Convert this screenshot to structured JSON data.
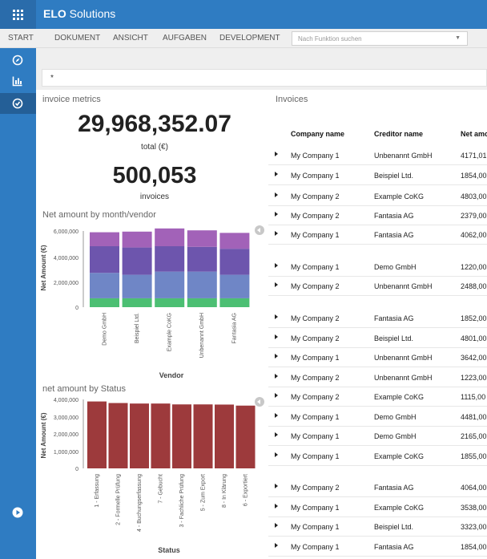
{
  "app": {
    "brand": "ELO",
    "name": "Solutions"
  },
  "menu": [
    "START",
    "DOKUMENT",
    "ANSICHT",
    "AUFGABEN",
    "DEVELOPMENT"
  ],
  "function_search": {
    "placeholder": "Nach Funktion suchen"
  },
  "sidebar": {
    "icons": [
      "compass-icon",
      "bar-chart-icon",
      "dashboard-icon"
    ],
    "bottom_icon": "play-circle-icon"
  },
  "search": {
    "value": "*"
  },
  "metrics": {
    "title": "invoice metrics",
    "total": "29,968,352.07",
    "total_label": "total (€)",
    "count": "500,053",
    "count_label": "invoices"
  },
  "charts": {
    "vendor": {
      "title": "Net amount by month/vendor",
      "ticks": [
        "6,000,000",
        "4,000,000",
        "2,000,000",
        "0"
      ],
      "ylabel": "Net Amount (€)",
      "xlabel": "Vendor"
    },
    "status": {
      "title": "net amount by Status",
      "ticks": [
        "4,000,000",
        "3,000,000",
        "2,000,000",
        "1,000,000",
        "0"
      ],
      "ylabel": "Net Amount (€)",
      "xlabel": "Status"
    }
  },
  "chart_data": [
    {
      "type": "bar",
      "title": "Net amount by month/vendor",
      "xlabel": "Vendor",
      "ylabel": "Net Amount (€)",
      "ylim": [
        0,
        6500000
      ],
      "categories": [
        "Demo GmbH",
        "Beispiel Ltd.",
        "Example CoKG",
        "Unbenannt GmbH",
        "Fantasia AG"
      ],
      "stacked": true,
      "series": [
        {
          "values": [
            700000,
            700000,
            700000,
            700000,
            700000
          ],
          "color": "#4cbf73"
        },
        {
          "values": [
            2000000,
            1850000,
            2100000,
            2100000,
            1850000
          ],
          "color": "#6f86c6"
        },
        {
          "values": [
            2100000,
            2150000,
            2000000,
            1950000,
            2050000
          ],
          "color": "#6d55ad"
        },
        {
          "values": [
            1100000,
            1250000,
            1400000,
            1300000,
            1250000
          ],
          "color": "#a262b8"
        }
      ]
    },
    {
      "type": "bar",
      "title": "net amount by Status",
      "xlabel": "Status",
      "ylabel": "Net Amount (€)",
      "ylim": [
        0,
        4000000
      ],
      "categories": [
        "1 - Erfassung",
        "2 - Formelle Prüfung",
        "4 - Buchungserfassung",
        "7 - Gebucht",
        "3 - Fachliche Prüfung",
        "5 - Zum Export",
        "8 - In Klärung",
        "6 - Exportiert"
      ],
      "series": [
        {
          "values": [
            3880000,
            3790000,
            3760000,
            3760000,
            3710000,
            3710000,
            3700000,
            3640000
          ],
          "color": "#9d3a3c"
        }
      ]
    }
  ],
  "invoices": {
    "title": "Invoices",
    "columns": [
      "Company name",
      "Creditor name",
      "Net amo"
    ],
    "rows": [
      {
        "company": "My Company 1",
        "creditor": "Unbenannt GmbH",
        "net": "4171,01"
      },
      {
        "company": "My Company 1",
        "creditor": "Beispiel Ltd.",
        "net": "1854,00"
      },
      {
        "company": "My Company 2",
        "creditor": "Example CoKG",
        "net": "4803,00"
      },
      {
        "company": "My Company 2",
        "creditor": "Fantasia AG",
        "net": "2379,00"
      },
      {
        "company": "My Company 1",
        "creditor": "Fantasia AG",
        "net": "4062,00"
      },
      {
        "company": "My Company 1",
        "creditor": "Demo GmbH",
        "net": "1220,00"
      },
      {
        "company": "My Company 2",
        "creditor": "Unbenannt GmbH",
        "net": "2488,00"
      },
      {
        "company": "My Company 2",
        "creditor": "Fantasia AG",
        "net": "1852,00"
      },
      {
        "company": "My Company 2",
        "creditor": "Beispiel Ltd.",
        "net": "4801,00"
      },
      {
        "company": "My Company 1",
        "creditor": "Unbenannt GmbH",
        "net": "3642,00"
      },
      {
        "company": "My Company 2",
        "creditor": "Unbenannt GmbH",
        "net": "1223,00"
      },
      {
        "company": "My Company 2",
        "creditor": "Example CoKG",
        "net": "1115,00"
      },
      {
        "company": "My Company 1",
        "creditor": "Demo GmbH",
        "net": "4481,00"
      },
      {
        "company": "My Company 1",
        "creditor": "Demo GmbH",
        "net": "2165,00"
      },
      {
        "company": "My Company 1",
        "creditor": "Example CoKG",
        "net": "1855,00"
      },
      {
        "company": "My Company 2",
        "creditor": "Fantasia AG",
        "net": "4064,00"
      },
      {
        "company": "My Company 1",
        "creditor": "Example CoKG",
        "net": "3538,00"
      },
      {
        "company": "My Company 1",
        "creditor": "Beispiel Ltd.",
        "net": "3323,00"
      },
      {
        "company": "My Company 1",
        "creditor": "Fantasia AG",
        "net": "1854,00"
      }
    ]
  }
}
